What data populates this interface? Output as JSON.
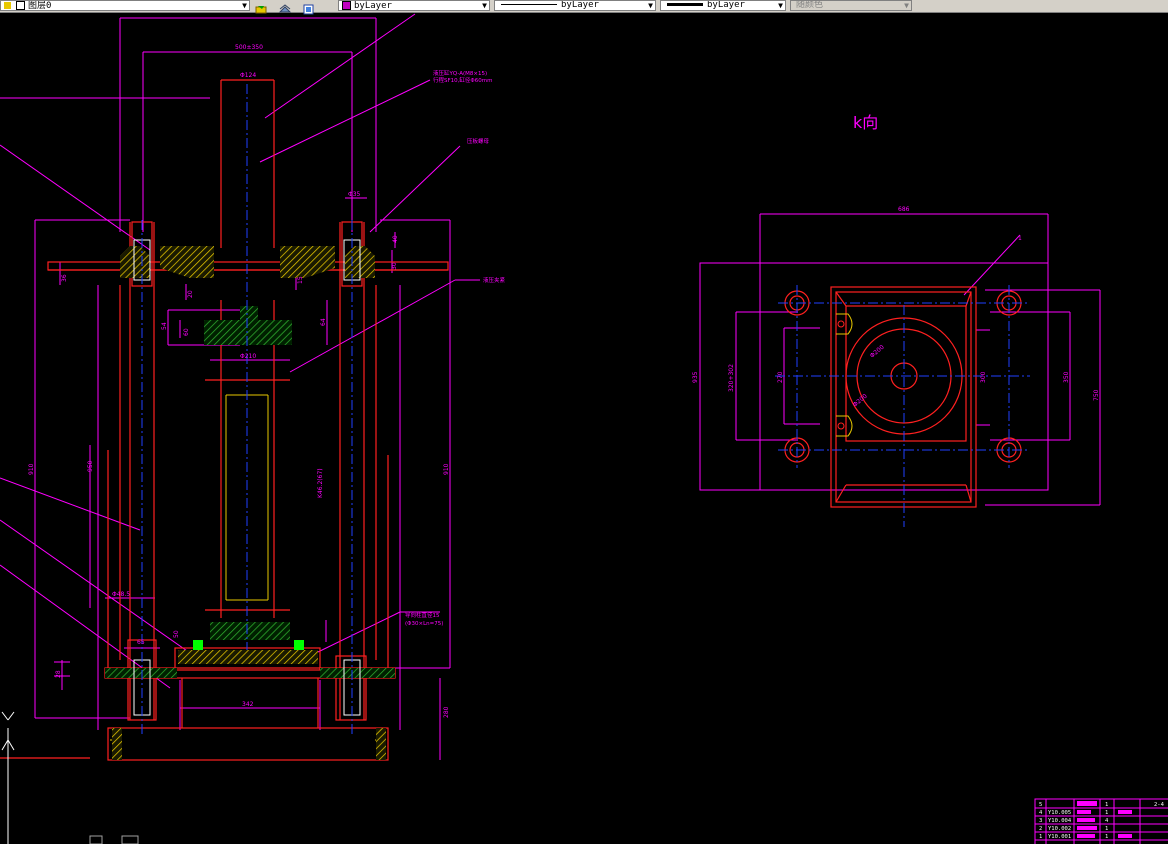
{
  "toolbar": {
    "layer_name": "图层0",
    "color_value": "byLayer",
    "linetype_value": "byLayer",
    "lineweight_value": "byLayer",
    "plotstyle_value": "随颜色"
  },
  "drawing": {
    "view_label": "k向",
    "main_dims": {
      "top_span": "500±350",
      "shaft_dia": "Φ124",
      "flange_dia": "Φ35",
      "dim_40": "40",
      "dim_30": "30",
      "dim_36": "36",
      "dim_20": "20",
      "dim_15": "15",
      "dim_54": "54",
      "dim_60": "60",
      "dim_64": "64",
      "dia_210": "Φ210",
      "dim_910_left": "910",
      "dim_910_right": "910",
      "dim_950": "950",
      "dim_stroke": "K46.2(67)",
      "dim_48": "Φ48.5",
      "dim_65": "65",
      "dim_50": "50",
      "dim_342": "342",
      "dim_28": "28",
      "dim_280": "280"
    },
    "annotations": {
      "note_top": "液压缸YQ-A(M8×15)",
      "note_top2": "行程SF10,缸径Φ60mm",
      "note_mid": "压板螺母",
      "note_clamp": "液压夹紧",
      "note_bottom": "导向柱直径15",
      "note_bottom2": "(Φ30×Ln=75)"
    },
    "k_view_dims": {
      "width_top": "686",
      "height_left": "935",
      "inner_left": "320+302",
      "inner_left2": "270",
      "inner_right": "300",
      "outer_right": "350",
      "far_right": "750",
      "circle_1": "Φ200",
      "circle_2": "Φ200",
      "leader_label": "1"
    },
    "title_block": [
      {
        "seq": "5",
        "code": "",
        "qty": "1",
        "extra": "",
        "note": "2-4"
      },
      {
        "seq": "4",
        "code": "Y10.005",
        "qty": "1",
        "extra": "",
        "note": ""
      },
      {
        "seq": "3",
        "code": "Y10.004",
        "qty": "4",
        "extra": "",
        "note": ""
      },
      {
        "seq": "2",
        "code": "Y10.002",
        "qty": "1",
        "extra": "",
        "note": ""
      },
      {
        "seq": "1",
        "code": "Y10.001",
        "qty": "1",
        "extra": "",
        "note": ""
      }
    ],
    "ucs_label": "Y"
  },
  "colors": {
    "background": "#000000",
    "red": "#ff2020",
    "magenta": "#ff00ff",
    "blue": "#0000ff",
    "yellow": "#e8c800",
    "green": "#00ff00",
    "white": "#ffffff"
  }
}
